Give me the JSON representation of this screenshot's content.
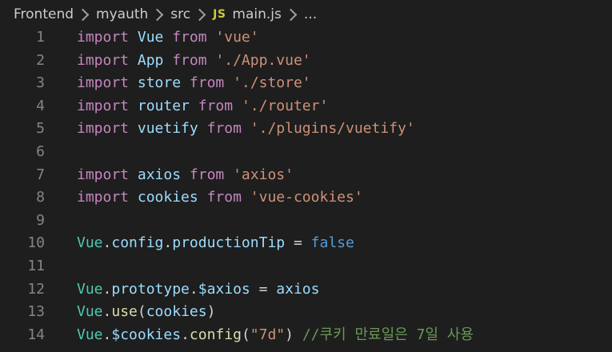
{
  "breadcrumb": {
    "items": [
      "Frontend",
      "myauth",
      "src"
    ],
    "file_icon": "JS",
    "file": "main.js",
    "more": "..."
  },
  "code": {
    "line_numbers": [
      "1",
      "2",
      "3",
      "4",
      "5",
      "6",
      "7",
      "8",
      "9",
      "10",
      "11",
      "12",
      "13",
      "14"
    ],
    "l1": [
      "import",
      " Vue ",
      "from",
      " ",
      "'vue'"
    ],
    "l2": [
      "import",
      " App ",
      "from",
      " ",
      "'./App.vue'"
    ],
    "l3": [
      "import",
      " store ",
      "from",
      " ",
      "'./store'"
    ],
    "l4": [
      "import",
      " router ",
      "from",
      " ",
      "'./router'"
    ],
    "l5": [
      "import",
      " vuetify ",
      "from",
      " ",
      "'./plugins/vuetify'"
    ],
    "l7": [
      "import",
      " axios ",
      "from",
      " ",
      "'axios'"
    ],
    "l8": [
      "import",
      " cookies ",
      "from",
      " ",
      "'vue-cookies'"
    ],
    "l10": [
      "Vue",
      ".",
      "config",
      ".",
      "productionTip",
      " = ",
      "false"
    ],
    "l12": [
      "Vue",
      ".",
      "prototype",
      ".",
      "$axios",
      " = ",
      "axios"
    ],
    "l13": [
      "Vue",
      ".",
      "use",
      "(",
      "cookies",
      ")"
    ],
    "l14": [
      "Vue",
      ".",
      "$cookies",
      ".",
      "config",
      "(",
      "\"7d\"",
      ") ",
      "//쿠키 만료일은 7일 사용"
    ]
  },
  "colors": {
    "background": "#1e1e1e",
    "keyword": "#c586c0",
    "variable": "#9cdcfe",
    "string": "#ce9178",
    "class": "#4ec9b0",
    "function": "#dcdcaa",
    "boolean": "#569cd6",
    "comment": "#6a9955",
    "line_number": "#858585"
  }
}
